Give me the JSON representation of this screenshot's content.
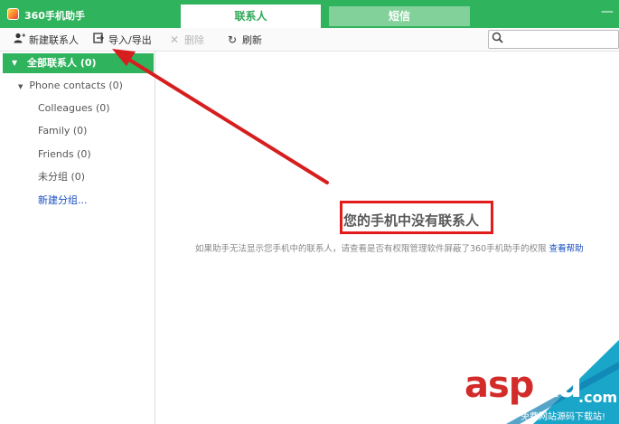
{
  "app": {
    "title": "360手机助手",
    "tabs": [
      {
        "label": "联系人",
        "active": true
      },
      {
        "label": "短信",
        "active": false
      }
    ],
    "minimize_glyph": "—"
  },
  "toolbar": {
    "new_contact": "新建联系人",
    "import_export": "导入/导出",
    "delete": "删除",
    "refresh": "刷新",
    "search_placeholder": ""
  },
  "sidebar": {
    "all_contacts": "全部联系人 (0)",
    "phone_contacts": "Phone contacts (0)",
    "groups": [
      {
        "label": "Colleagues (0)"
      },
      {
        "label": "Family (0)"
      },
      {
        "label": "Friends (0)"
      },
      {
        "label": "未分组 (0)"
      }
    ],
    "new_group": "新建分组..."
  },
  "main": {
    "empty_title": "您的手机中没有联系人",
    "empty_hint": "如果助手无法显示您手机中的联系人，请查看是否有权限管理软件屏蔽了360手机助手的权限",
    "help_link": "查看帮助"
  },
  "watermark": {
    "asp": "asp",
    "ku": "ku",
    "com": ".com",
    "sub": "免费网站源码下载站!"
  },
  "colors": {
    "brand_green": "#2fb35c",
    "annotation_red": "#e21b1b",
    "link_blue": "#1a4fc0"
  },
  "icons": {
    "new_contact": "add-user-icon",
    "import_export": "import-export-icon",
    "delete": "close-icon",
    "refresh": "refresh-icon",
    "search": "search-icon"
  }
}
